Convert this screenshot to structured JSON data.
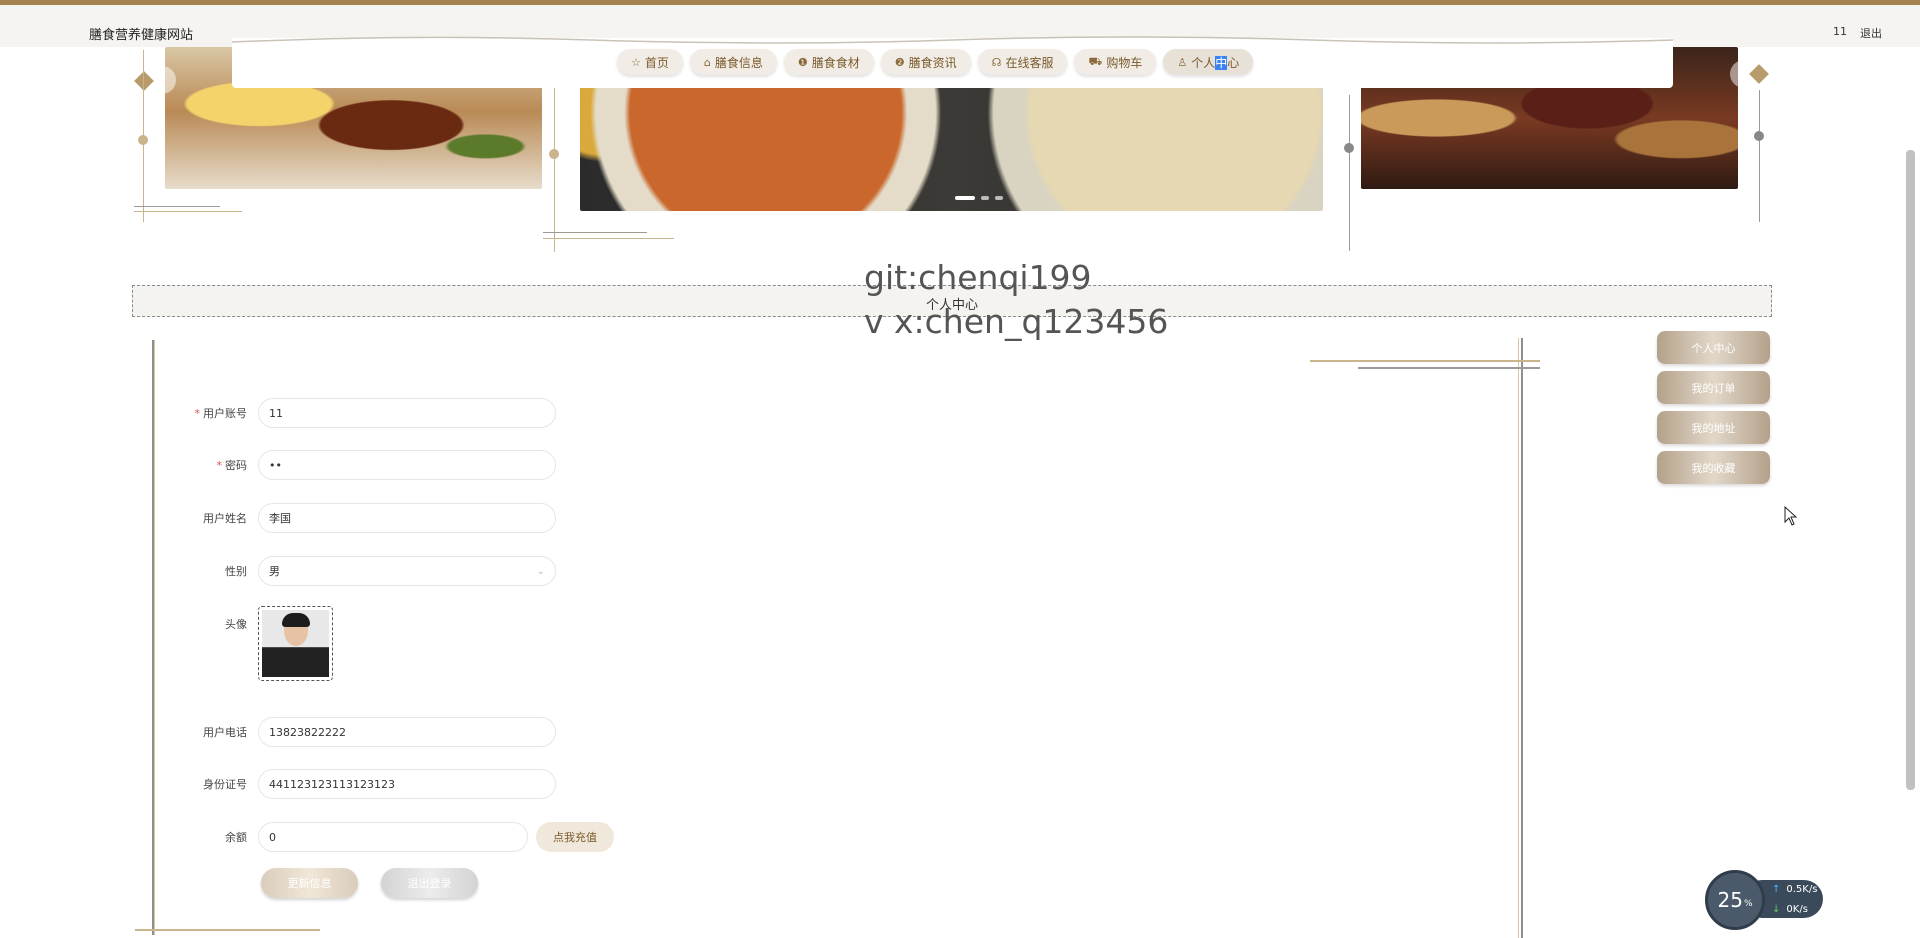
{
  "header": {
    "site_title": "膳食营养健康网站",
    "user_name": "11",
    "logout_label": "退出"
  },
  "nav": {
    "items": [
      {
        "icon": "star-icon",
        "glyph": "☆",
        "label": "首页"
      },
      {
        "icon": "bag-icon",
        "glyph": "⌂",
        "label": "膳食信息"
      },
      {
        "icon": "info-icon",
        "glyph": "❶",
        "label": "膳食食材"
      },
      {
        "icon": "question-icon",
        "glyph": "❷",
        "label": "膳食资讯"
      },
      {
        "icon": "headset-icon",
        "glyph": "☊",
        "label": "在线客服"
      },
      {
        "icon": "cart-icon",
        "glyph": "⛟",
        "label": "购物车"
      },
      {
        "icon": "user-icon",
        "glyph": "♙",
        "label": "个人中心",
        "label_pre": "个人",
        "label_sel": "中",
        "label_post": "心"
      }
    ],
    "active_index": 6
  },
  "banner": {
    "slide_count": 3,
    "active_slide": 0
  },
  "page": {
    "title": "个人中心",
    "watermark_line1": "git:chenqi199",
    "watermark_line2": "v x:chen_q123456"
  },
  "form": {
    "account_label": "用户账号",
    "account_value": "11",
    "password_label": "密码",
    "password_value": "••",
    "name_label": "用户姓名",
    "name_value": "李国",
    "gender_label": "性别",
    "gender_value": "男",
    "avatar_label": "头像",
    "phone_label": "用户电话",
    "phone_value": "13823822222",
    "id_label": "身份证号",
    "id_value": "441123123113123123",
    "balance_label": "余额",
    "balance_value": "0",
    "recharge_label": "点我充值",
    "update_label": "更新信息",
    "logout_label": "退出登录"
  },
  "side_menu": {
    "items": [
      "个人中心",
      "我的订单",
      "我的地址",
      "我的收藏"
    ]
  },
  "widget": {
    "percent": "25",
    "percent_unit": "%",
    "up_speed": "0.5",
    "down_speed": "0",
    "unit": "K/s"
  },
  "colors": {
    "accent": "#a6824e",
    "nav_text": "#7a5a2b",
    "side_btn": "#b4a18a"
  }
}
